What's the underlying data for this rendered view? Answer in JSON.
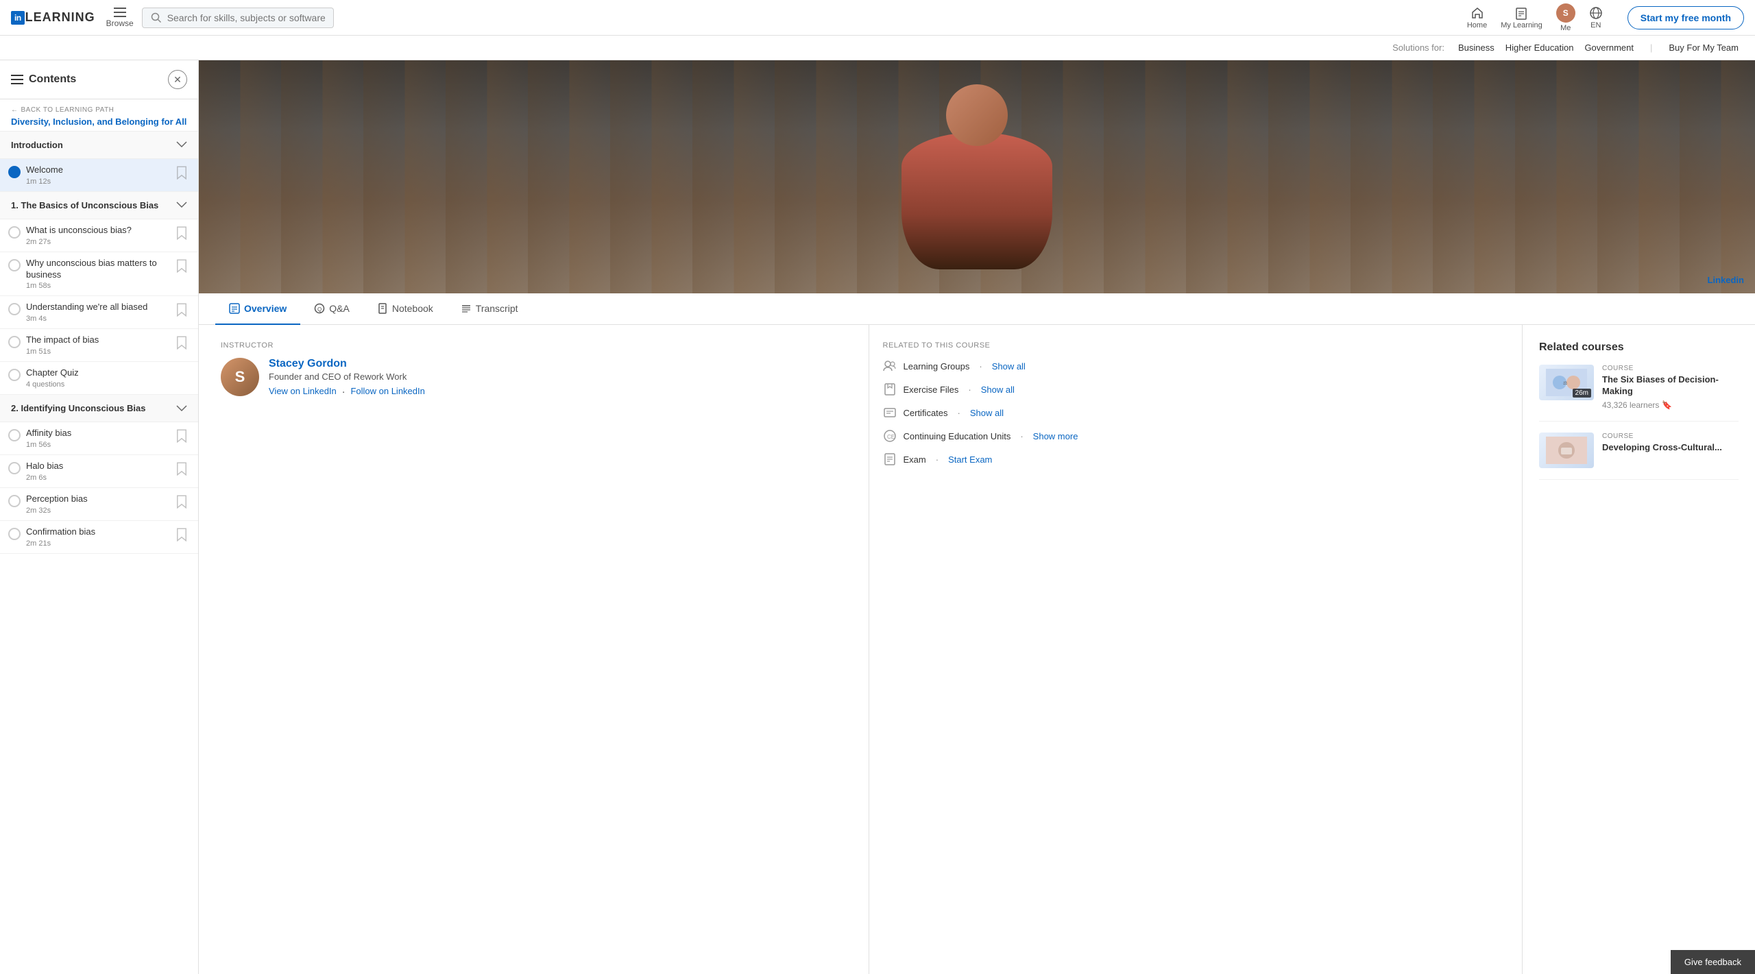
{
  "nav": {
    "logo_in": "in",
    "logo_text": "LEARNING",
    "browse_label": "Browse",
    "search_placeholder": "Search for skills, subjects or software",
    "home_label": "Home",
    "my_learning_label": "My Learning",
    "me_label": "Me",
    "lang_label": "EN",
    "cta_label": "Start my free month"
  },
  "solutions_bar": {
    "label": "Solutions for:",
    "business": "Business",
    "higher_education": "Higher Education",
    "government": "Government",
    "buy": "Buy For My Team"
  },
  "sidebar": {
    "title": "Contents",
    "back_label": "BACK TO LEARNING PATH",
    "back_path_title": "Diversity, Inclusion, and Belonging for All",
    "sections": [
      {
        "id": "intro",
        "label": "Introduction",
        "expanded": true,
        "lessons": [
          {
            "id": "welcome",
            "name": "Welcome",
            "duration": "1m 12s",
            "active": true,
            "bookmarked": false
          }
        ]
      },
      {
        "id": "section1",
        "label": "1. The Basics of Unconscious Bias",
        "expanded": true,
        "lessons": [
          {
            "id": "what-is",
            "name": "What is unconscious bias?",
            "duration": "2m 27s",
            "active": false,
            "bookmarked": false
          },
          {
            "id": "why-matters",
            "name": "Why unconscious bias matters to business",
            "duration": "1m 58s",
            "active": false,
            "bookmarked": false
          },
          {
            "id": "were-all",
            "name": "Understanding we're all biased",
            "duration": "3m 4s",
            "active": false,
            "bookmarked": false
          },
          {
            "id": "impact",
            "name": "The impact of bias",
            "duration": "1m 51s",
            "active": false,
            "bookmarked": false
          },
          {
            "id": "quiz1",
            "name": "Chapter Quiz",
            "duration": "4 questions",
            "active": false,
            "bookmarked": false
          }
        ]
      },
      {
        "id": "section2",
        "label": "2. Identifying Unconscious Bias",
        "expanded": true,
        "lessons": [
          {
            "id": "affinity",
            "name": "Affinity bias",
            "duration": "1m 56s",
            "active": false,
            "bookmarked": false
          },
          {
            "id": "halo",
            "name": "Halo bias",
            "duration": "2m 6s",
            "active": false,
            "bookmarked": false
          },
          {
            "id": "perception",
            "name": "Perception bias",
            "duration": "2m 32s",
            "active": false,
            "bookmarked": false
          },
          {
            "id": "confirmation",
            "name": "Confirmation bias",
            "duration": "2m 21s",
            "active": false,
            "bookmarked": false
          }
        ]
      }
    ]
  },
  "tabs": [
    {
      "id": "overview",
      "label": "Overview",
      "active": true
    },
    {
      "id": "qa",
      "label": "Q&A",
      "active": false
    },
    {
      "id": "notebook",
      "label": "Notebook",
      "active": false
    },
    {
      "id": "transcript",
      "label": "Transcript",
      "active": false
    }
  ],
  "instructor": {
    "section_label": "INSTRUCTOR",
    "name": "Stacey Gordon",
    "title": "Founder and CEO of Rework Work",
    "view_link": "View on LinkedIn",
    "follow_link": "Follow on LinkedIn"
  },
  "related": {
    "section_label": "RELATED TO THIS COURSE",
    "items": [
      {
        "id": "learning-groups",
        "label": "Learning Groups",
        "link": "Show all"
      },
      {
        "id": "exercise-files",
        "label": "Exercise Files",
        "link": "Show all"
      },
      {
        "id": "certificates",
        "label": "Certificates",
        "link": "Show all"
      },
      {
        "id": "ceu",
        "label": "Continuing Education Units",
        "link": "Show more"
      },
      {
        "id": "exam",
        "label": "Exam",
        "link": "Start Exam"
      }
    ]
  },
  "right_panel": {
    "title": "Related courses",
    "courses": [
      {
        "id": "c1",
        "type": "COURSE",
        "name": "The Six Biases of Decision-Making",
        "learners": "43,326 learners",
        "duration": "26m",
        "bookmarked": true
      },
      {
        "id": "c2",
        "type": "COURSE",
        "name": "Developing Cross-Cultural...",
        "learners": "",
        "duration": "",
        "bookmarked": false
      }
    ]
  },
  "feedback": {
    "label": "Give feedback"
  },
  "video": {
    "watermark": "Linked",
    "watermark_highlight": "in"
  }
}
